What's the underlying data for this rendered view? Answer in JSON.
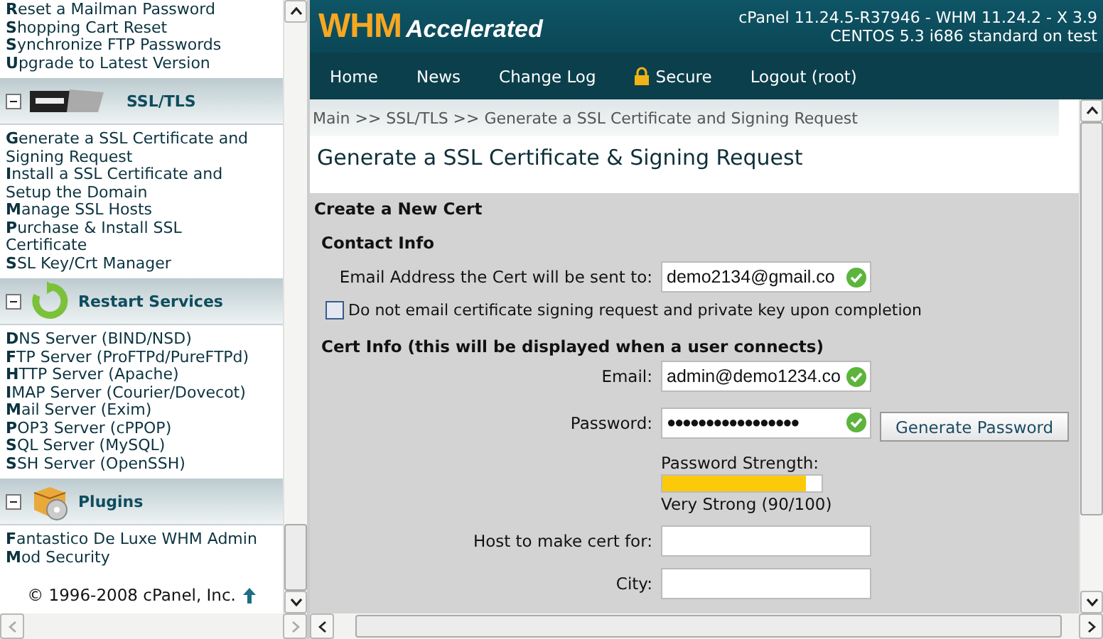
{
  "sidebar": {
    "top_items": [
      "**R**eset a Mailman Password",
      "**S**hopping Cart Reset",
      "**S**ynchronize FTP Passwords",
      "**U**pgrade to Latest Version"
    ],
    "sections": [
      {
        "title": "SSL/TLS",
        "kind": "ssl",
        "expanded": true,
        "items": [
          "**G**enerate a SSL Certificate and Signing Request",
          "**I**nstall a SSL Certificate and Setup the Domain",
          "**M**anage SSL Hosts",
          "**P**urchase & Install SSL Certificate",
          "**S**SL Key/Crt Manager"
        ]
      },
      {
        "title": "Restart Services",
        "kind": "restart",
        "expanded": true,
        "items": [
          "**D**NS Server (BIND/NSD)",
          "**F**TP Server (ProFTPd/PureFTPd)",
          "**H**TTP Server (Apache)",
          "**I**MAP Server (Courier/Dovecot)",
          "**M**ail Server (Exim)",
          "**P**OP3 Server (cPPOP)",
          "**S**QL Server (MySQL)",
          "**S**SH Server (OpenSSH)"
        ]
      },
      {
        "title": "Plugins",
        "kind": "plugins",
        "expanded": true,
        "items": [
          "**F**antastico De Luxe WHM Admin",
          "**M**od Security"
        ]
      }
    ],
    "copyright": "© 1996-2008 cPanel, Inc."
  },
  "header": {
    "logo_main": "WHM",
    "logo_sub": "Accelerated",
    "version_lines": [
      "cPanel 11.24.5-R37946 - WHM 11.24.2 - X 3.9",
      "CENTOS 5.3 i686 standard on test"
    ]
  },
  "nav": [
    {
      "label": "Home",
      "kind": "link"
    },
    {
      "label": "News",
      "kind": "link"
    },
    {
      "label": "Change Log",
      "kind": "link"
    },
    {
      "label": "Secure",
      "kind": "lock"
    },
    {
      "label": "Logout (root)",
      "kind": "link"
    }
  ],
  "breadcrumb": "Main >> SSL/TLS >> Generate a SSL Certificate and Signing Request",
  "page_title": "Generate a SSL Certificate & Signing Request",
  "form": {
    "heading": "Create a New Cert",
    "contact": {
      "title": "Contact Info",
      "fields": [
        {
          "label": "Email Address the Cert will be sent to:",
          "value": "demo2134@gmail.co",
          "valid": true
        }
      ],
      "checkbox": {
        "label": "Do not email certificate signing request and private key upon completion",
        "checked": false
      }
    },
    "cert": {
      "title": "Cert Info (this will be displayed when a user connects)",
      "fields": [
        {
          "label": "Email:",
          "value": "admin@demo1234.co",
          "valid": true
        },
        {
          "label": "Password:",
          "value": "●●●●●●●●●●●●●●●●●",
          "valid": true,
          "button": "Generate Password"
        }
      ],
      "strength": {
        "label": "Password Strength:",
        "level": 0.9,
        "reading": "Very Strong (90/100)"
      },
      "more_fields": [
        {
          "label": "Host to make cert for:"
        },
        {
          "label": "City:"
        }
      ]
    }
  }
}
